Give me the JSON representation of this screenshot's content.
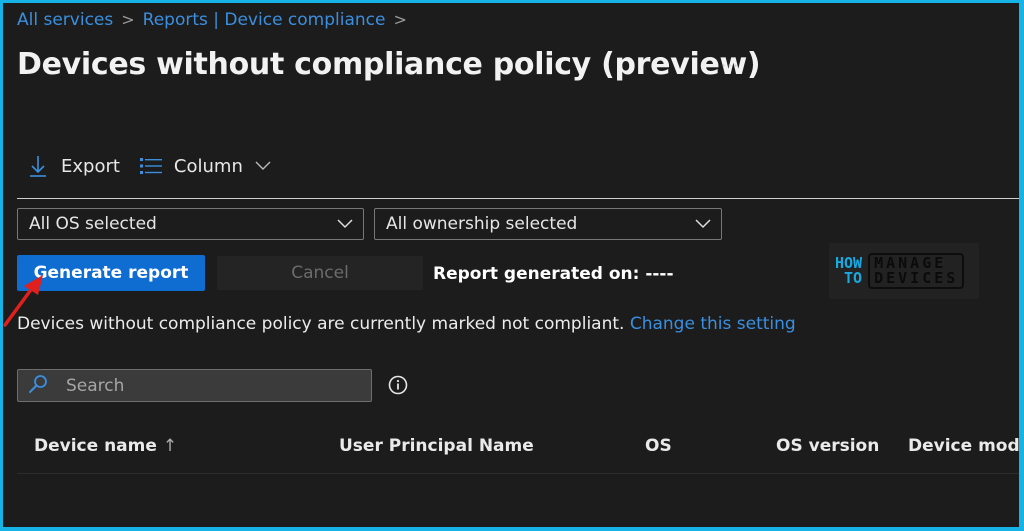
{
  "breadcrumb": {
    "items": [
      "All services",
      "Reports | Device compliance"
    ],
    "separator": ">"
  },
  "page": {
    "title": "Devices without compliance policy (preview)",
    "more_label": "···"
  },
  "toolbar": {
    "export_label": "Export",
    "export_icon": "download-icon",
    "column_label": "Column",
    "column_icon": "list-icon"
  },
  "filters": {
    "os_selected": "All OS selected",
    "ownership_selected": "All ownership selected"
  },
  "actions": {
    "generate_label": "Generate report",
    "cancel_label": "Cancel",
    "report_generated_label": "Report generated on: ----"
  },
  "notice": {
    "text": "Devices without compliance policy are currently marked not compliant.",
    "link_label": "Change this setting"
  },
  "search": {
    "placeholder": "Search",
    "value": ""
  },
  "table": {
    "columns": [
      {
        "label": "Device name",
        "sort": "↑"
      },
      {
        "label": "User Principal Name"
      },
      {
        "label": "OS"
      },
      {
        "label": "OS version"
      },
      {
        "label": "Device model"
      }
    ],
    "rows": []
  },
  "watermark": {
    "line1": "HOW",
    "line2": "TO",
    "box_line1": "MANAGE",
    "box_line2": "DEVICES"
  },
  "colors": {
    "frame_border": "#16b4e6",
    "background": "#1c1c1c",
    "accent": "#0f6cd0",
    "link": "#3a8fe0",
    "annotation_arrow": "#e0201c"
  }
}
